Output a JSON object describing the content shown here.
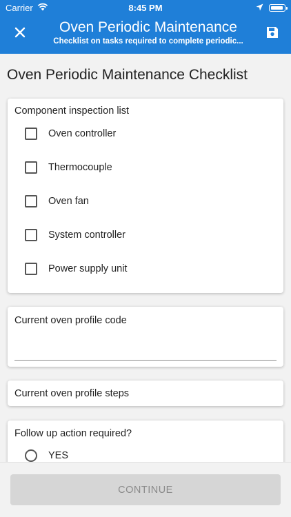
{
  "status_bar": {
    "carrier": "Carrier",
    "time": "8:45 PM",
    "icons": [
      "wifi-icon",
      "location-arrow-icon",
      "battery-icon"
    ]
  },
  "header": {
    "title": "Oven Periodic Maintenance",
    "subtitle": "Checklist on tasks required to complete periodic...",
    "close_icon": "close-icon",
    "save_icon": "save-icon",
    "background_color": "#1f7fd8"
  },
  "page": {
    "heading": "Oven Periodic Maintenance Checklist"
  },
  "component_inspection": {
    "label": "Component inspection list",
    "items": [
      {
        "label": "Oven controller",
        "checked": false
      },
      {
        "label": "Thermocouple",
        "checked": false
      },
      {
        "label": "Oven fan",
        "checked": false
      },
      {
        "label": "System controller",
        "checked": false
      },
      {
        "label": "Power supply unit",
        "checked": false
      }
    ]
  },
  "profile_code": {
    "label": "Current oven profile code",
    "value": ""
  },
  "profile_steps": {
    "label": "Current oven profile steps"
  },
  "follow_up": {
    "label": "Follow up action required?",
    "options": [
      {
        "label": "YES",
        "selected": false
      }
    ]
  },
  "footer": {
    "continue_label": "CONTINUE",
    "enabled": false
  }
}
